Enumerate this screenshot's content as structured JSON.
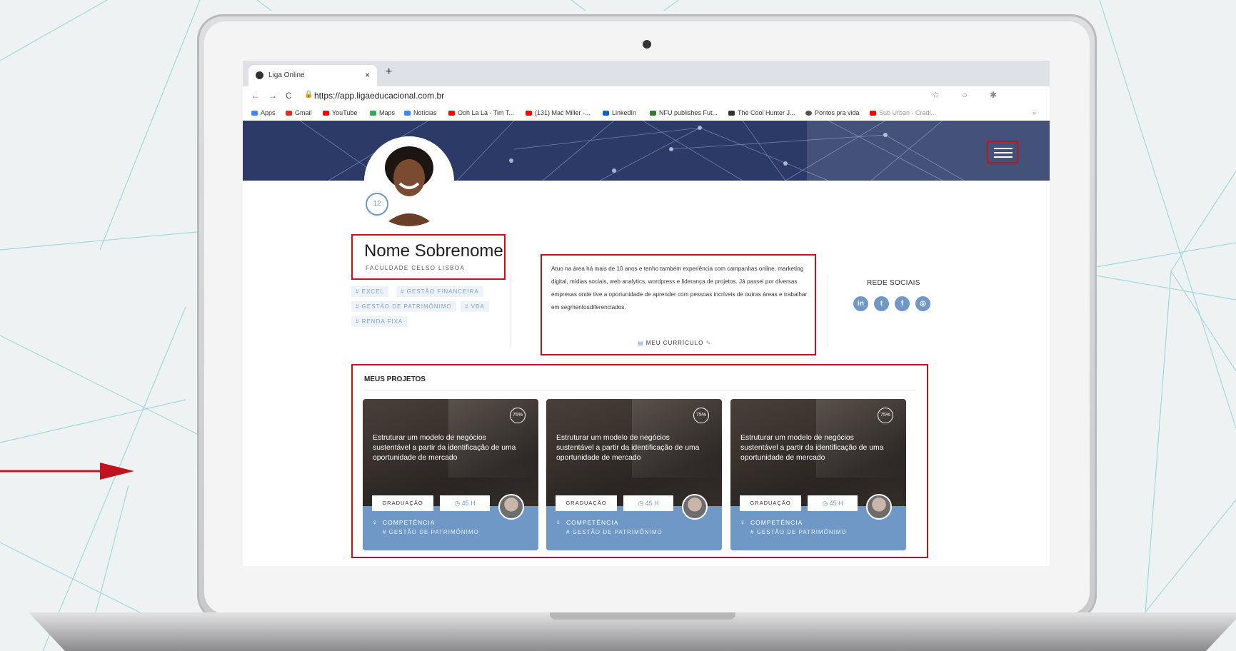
{
  "browser": {
    "tab_title": "Liga Online",
    "tab_close": "×",
    "new_tab": "+",
    "url": "https://app.ligaeducacional.com.br",
    "back": "←",
    "forward": "→",
    "reload": "C",
    "lock": "🔒",
    "addr_icons": "☆ ○ ✱",
    "bookmarks": [
      {
        "label": "Apps",
        "color": "#4285f4"
      },
      {
        "label": "Gmail",
        "color": "#d93025"
      },
      {
        "label": "YouTube",
        "color": "#ff0000"
      },
      {
        "label": "Maps",
        "color": "#34a853"
      },
      {
        "label": "Notícias",
        "color": "#4285f4"
      },
      {
        "label": "Ooh La La - Tim T...",
        "color": "#ff0000"
      },
      {
        "label": "(131) Mac Miller -...",
        "color": "#ff0000"
      },
      {
        "label": "LinkedIn",
        "color": "#0a66c2"
      },
      {
        "label": "NFU publishes Fut...",
        "color": "#2e7d32"
      },
      {
        "label": "The Cool Hunter J...",
        "color": "#333333"
      },
      {
        "label": "Pontos pra vida",
        "color": "#555555"
      },
      {
        "label": "Sub Urban - Cradl...",
        "color": "#ff0000"
      },
      {
        "label": "»",
        "color": "#ffffff"
      }
    ]
  },
  "profile": {
    "badge_number": "12",
    "name": "Nome Sobrenome",
    "school": "FACULDADE CELSO LISBOA",
    "tags": [
      "# EXCEL",
      "# GESTÃO FINANCEIRA",
      "# GESTÃO DE PATRIMÔNIMO",
      "# VBA",
      "# RENDA FIXA"
    ],
    "bio": "Atuo na área há mais de 10 anos e tenho também experiência com campanhas online, marketing digital, mídias sociais, web analytics, wordpress e liderança de projetos. Já passei por diversas empresas onde tive a oportunidade de aprender com pessoas incríveis de outras áreas e trabalhar em segmentosdiferenciados.",
    "cv_label": "MEU CURRÍCULO",
    "social_title": "REDE SOCIAIS",
    "social_icons": [
      {
        "icon": "linkedin-icon",
        "glyph": "in"
      },
      {
        "icon": "twitter-icon",
        "glyph": "t"
      },
      {
        "icon": "facebook-icon",
        "glyph": "f"
      },
      {
        "icon": "instagram-icon",
        "glyph": "◎"
      }
    ]
  },
  "projects": {
    "title": "MEUS PROJETOS",
    "items": [
      {
        "progress": "75%",
        "title": "Estruturar um modelo de negócios sustentável a partir da identificação de uma oportunidade de mercado",
        "level": "GRADUAÇÃO",
        "hours": "◷ 45 H",
        "competence": "COMPETÊNCIA",
        "skill": "# GESTÃO DE PATRIMÔNIMO"
      },
      {
        "progress": "75%",
        "title": "Estruturar um modelo de negócios sustentável a partir da identificação de uma oportunidade de mercado",
        "level": "GRADUAÇÃO",
        "hours": "◷ 45 H",
        "competence": "COMPETÊNCIA",
        "skill": "# GESTÃO DE PATRIMÔNIMO"
      },
      {
        "progress": "75%",
        "title": "Estruturar um modelo de negócios sustentável a partir da identificação de uma oportunidade de mercado",
        "level": "GRADUAÇÃO",
        "hours": "◷ 45 H",
        "competence": "COMPETÊNCIA",
        "skill": "# GESTÃO DE PATRIMÔNIMO"
      }
    ]
  },
  "colors": {
    "accent_red": "#c1121f",
    "brand_blue": "#6f98c6",
    "banner_navy": "#2b3a66"
  }
}
